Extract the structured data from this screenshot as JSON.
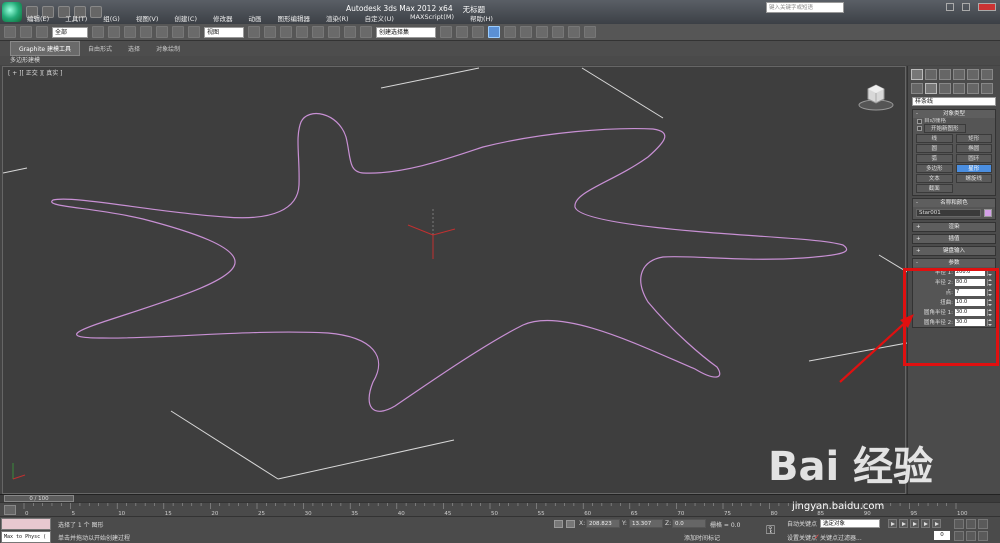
{
  "window": {
    "title": "Autodesk 3ds Max  2012 x64",
    "file_name": "无标题",
    "help_search_placeholder": "键入关键字或短语"
  },
  "menu": [
    "编辑(E)",
    "工具(T)",
    "组(G)",
    "视图(V)",
    "创建(C)",
    "修改器",
    "动画",
    "图形编辑器",
    "渲染(R)",
    "自定义(U)",
    "MAXScript(M)",
    "帮助(H)"
  ],
  "toolbar": {
    "selection_filter": "全部",
    "reference_coord": "视图",
    "named_selection_set": "创建选择集"
  },
  "ribbon": {
    "tabs": [
      "Graphite 建模工具",
      "自由形式",
      "选择",
      "对象绘制"
    ],
    "sub_label": "多边形建模"
  },
  "viewport": {
    "label": "[ + ][ 正交 ][ 真实 ]",
    "shape_color": "#c890d4"
  },
  "command_panel": {
    "category": "样条线",
    "object_type": {
      "title": "对象类型",
      "autogrid": "自动栅格",
      "start_new_shape": "开始新图形",
      "buttons": [
        {
          "label": "线",
          "active": false
        },
        {
          "label": "矩形",
          "active": false
        },
        {
          "label": "圆",
          "active": false
        },
        {
          "label": "椭圆",
          "active": false
        },
        {
          "label": "弧",
          "active": false
        },
        {
          "label": "圆环",
          "active": false
        },
        {
          "label": "多边形",
          "active": false
        },
        {
          "label": "星形",
          "active": true
        },
        {
          "label": "文本",
          "active": false
        },
        {
          "label": "螺旋线",
          "active": false
        },
        {
          "label": "截面",
          "active": false
        }
      ]
    },
    "name_color": {
      "title": "名称和颜色",
      "name": "Star001",
      "color": "#d4a0e8"
    },
    "rollouts_collapsed": [
      "渲染",
      "插值",
      "键盘输入"
    ],
    "parameters": {
      "title": "参数",
      "rows": [
        {
          "label": "半径 1:",
          "value": "200.0"
        },
        {
          "label": "半径 2:",
          "value": "80.0"
        },
        {
          "label": "点:",
          "value": "7"
        },
        {
          "label": "扭曲:",
          "value": "10.0"
        },
        {
          "label": "圆角半径 1:",
          "value": "30.0"
        },
        {
          "label": "圆角半径 2:",
          "value": "30.0"
        }
      ]
    }
  },
  "timeline": {
    "slider_label": "0 / 100",
    "ticks": [
      "0",
      "5",
      "10",
      "15",
      "20",
      "25",
      "30",
      "35",
      "40",
      "45",
      "50",
      "55",
      "60",
      "65",
      "70",
      "75",
      "80",
      "85",
      "90",
      "95",
      "100"
    ]
  },
  "status": {
    "maxscript_output": "Max to Physc (",
    "selected": "选择了 1 个 图形",
    "prompt": "单击并拖动以开始创建过程",
    "x": "208.823",
    "y": "13.307",
    "z": "0.0",
    "grid": "栅格 = 0.0",
    "add_time_tag": "添加时间标记",
    "auto_key": "自动关键点",
    "set_key": "设置关键点",
    "selection_dropdown": "选定对象",
    "key_filters": "关键点过滤器...",
    "frame": "0"
  },
  "watermark": {
    "brand": "Bai 经验",
    "url": "jingyan.baidu.com"
  }
}
